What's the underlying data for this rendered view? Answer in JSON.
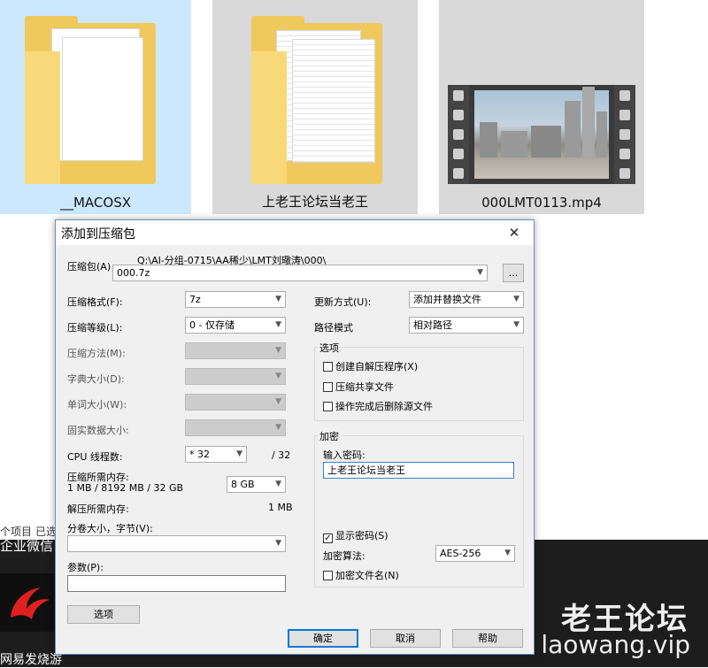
{
  "explorer": {
    "files": [
      {
        "name": "__MACOSX",
        "type": "folder",
        "selected": true
      },
      {
        "name": "上老王论坛当老王",
        "type": "folder",
        "selected": false
      },
      {
        "name": "000LMT0113.mp4",
        "type": "video",
        "selected": false
      }
    ],
    "side_text_items": "个项目",
    "side_text_selected": "已选",
    "taskbar_label": "企业微信",
    "app_label": "网易发烧游"
  },
  "watermark": {
    "cn": "老王论坛",
    "en": "laowang.vip"
  },
  "dialog": {
    "title": "添加到压缩包",
    "archive": {
      "label": "压缩包(A)",
      "path": "Q:\\AI-分组-0715\\AA稀少\\LMT刘璥涛\\000\\",
      "value": "000.7z",
      "browse_label": "..."
    },
    "format": {
      "label": "压缩格式(F):",
      "value": "7z"
    },
    "level": {
      "label": "压缩等级(L):",
      "value": "0 - 仅存储"
    },
    "method": {
      "label": "压缩方法(M):",
      "value": ""
    },
    "dict_size": {
      "label": "字典大小(D):",
      "value": ""
    },
    "word_size": {
      "label": "单词大小(W):",
      "value": ""
    },
    "solid_size": {
      "label": "固实数据大小:",
      "value": ""
    },
    "threads": {
      "label": "CPU 线程数:",
      "value": "* 32",
      "max": "/ 32"
    },
    "memory": {
      "label": "压缩所需内存:",
      "detail": "1 MB / 8192 MB / 32 GB",
      "value": "8 GB"
    },
    "decompress_memory": {
      "label": "解压所需内存:",
      "value": "1 MB"
    },
    "volume": {
      "label": "分卷大小，字节(V):",
      "value": ""
    },
    "params": {
      "label": "参数(P):",
      "value": ""
    },
    "options_button": "选项",
    "update_mode": {
      "label": "更新方式(U):",
      "value": "添加并替换文件"
    },
    "path_mode": {
      "label": "路径模式",
      "value": "相对路径"
    },
    "options_group": {
      "title": "选项",
      "sfx": {
        "label": "创建自解压程序(X)",
        "checked": false
      },
      "shared": {
        "label": "压缩共享文件",
        "checked": false
      },
      "delete": {
        "label": "操作完成后删除源文件",
        "checked": false
      }
    },
    "encryption": {
      "title": "加密",
      "password_label": "输入密码:",
      "password_value": "上老王论坛当老王",
      "show_password": {
        "label": "显示密码(S)",
        "checked": true
      },
      "method_label": "加密算法:",
      "method_value": "AES-256",
      "encrypt_names": {
        "label": "加密文件名(N)",
        "checked": false
      }
    },
    "buttons": {
      "ok": "确定",
      "cancel": "取消",
      "help": "帮助"
    }
  },
  "colors": {
    "selected_tile": "#cce8ff",
    "tile": "#d9d9d9",
    "folder": "#f0c95d",
    "dialog_bg": "#f0f0f0",
    "focus_border": "#3c7fd1"
  }
}
